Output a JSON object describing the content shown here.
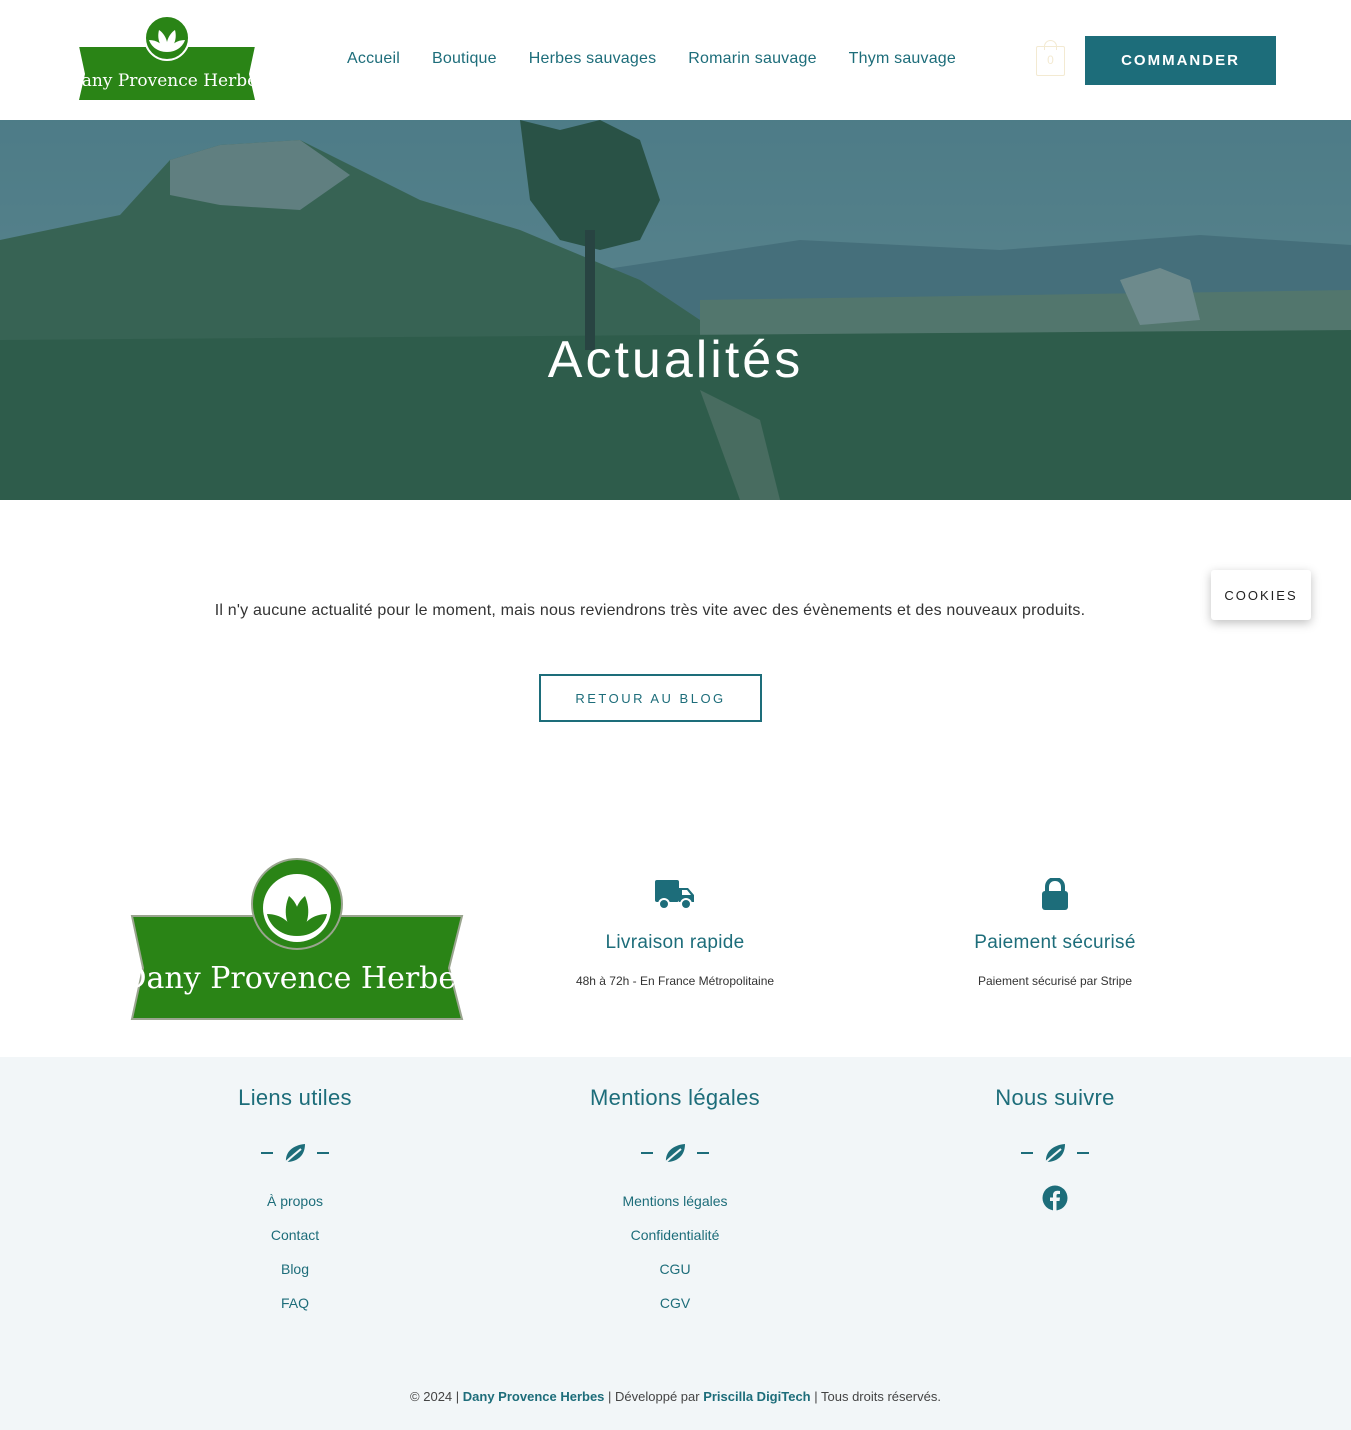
{
  "header": {
    "logo_text": "Dany Provence Herbes",
    "nav": [
      "Accueil",
      "Boutique",
      "Herbes sauvages",
      "Romarin sauvage",
      "Thym sauvage"
    ],
    "cart_count": "0",
    "order_button": "COMMANDER"
  },
  "hero": {
    "title": "Actualités"
  },
  "main": {
    "message": "Il n'y aucune actualité pour le moment, mais nous reviendrons très vite avec des évènements et des nouveaux produits.",
    "back_button": "RETOUR AU BLOG"
  },
  "cookies_button": "COOKIES",
  "features": {
    "logo_text": "Dany Provence Herbes",
    "delivery": {
      "icon": "truck-icon",
      "title": "Livraison rapide",
      "text": "48h à 72h - En France Métropolitaine"
    },
    "payment": {
      "icon": "lock-icon",
      "title": "Paiement sécurisé",
      "text": "Paiement sécurisé par Stripe"
    }
  },
  "footer": {
    "useful": {
      "title": "Liens utiles",
      "links": [
        "À propos",
        "Contact",
        "Blog",
        "FAQ"
      ]
    },
    "legal": {
      "title": "Mentions légales",
      "links": [
        "Mentions légales",
        "Confidentialité",
        "CGU",
        "CGV"
      ]
    },
    "follow": {
      "title": "Nous suivre",
      "icon": "facebook-icon"
    },
    "copyright": {
      "prefix": "© 2024 |",
      "brand": "Dany Provence Herbes",
      "middle": "| Développé par",
      "developer": "Priscilla DigiTech",
      "suffix": "| Tous droits réservés."
    }
  },
  "colors": {
    "primary": "#1d6d7a",
    "logo_green": "#2a8416",
    "footer_bg": "#f2f6f8"
  }
}
